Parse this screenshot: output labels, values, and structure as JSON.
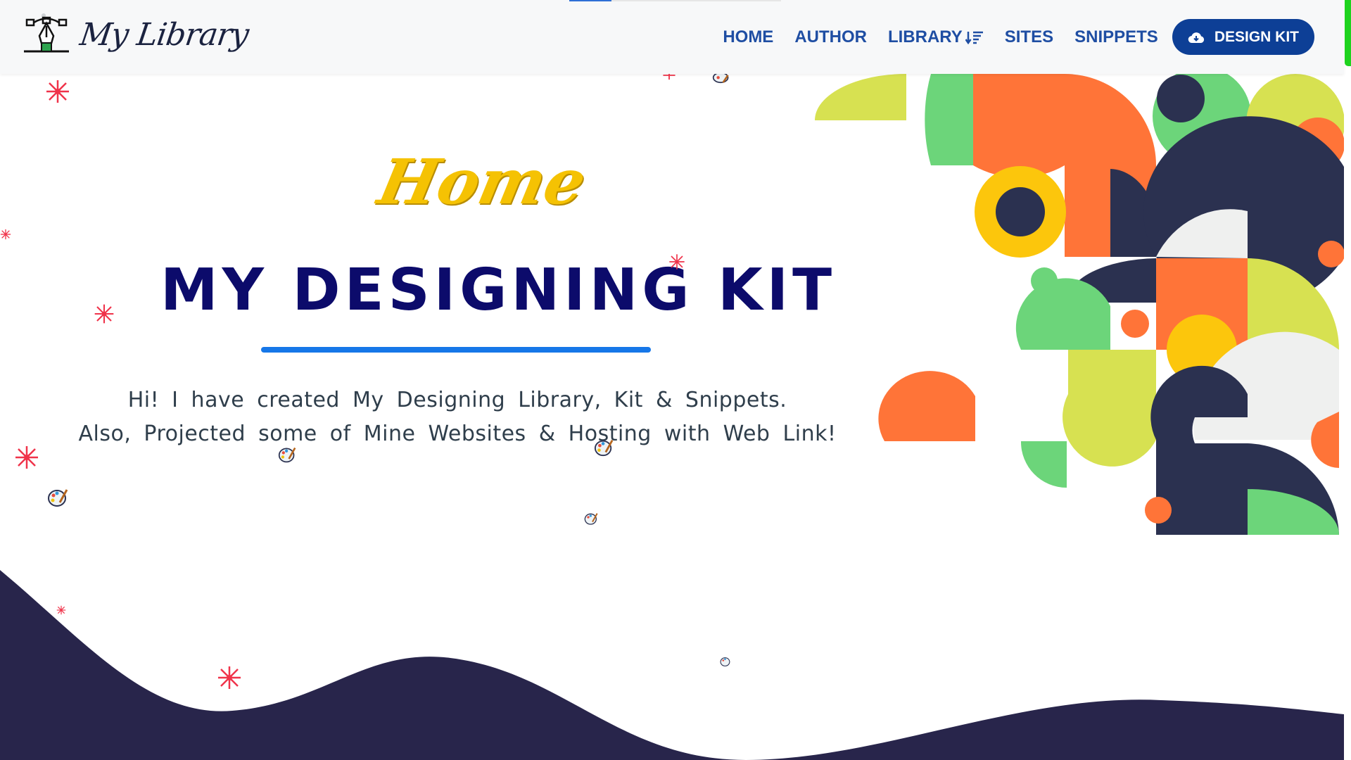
{
  "brand": {
    "name": "My Library"
  },
  "nav": {
    "items": [
      {
        "label": "HOME",
        "icon": ""
      },
      {
        "label": "AUTHOR",
        "icon": ""
      },
      {
        "label": "LIBRARY",
        "icon": "sort-icon"
      },
      {
        "label": "SITES",
        "icon": ""
      },
      {
        "label": "SNIPPETS",
        "icon": ""
      }
    ],
    "cta": {
      "label": "DESIGN KIT",
      "icon": "cloud-download-icon"
    }
  },
  "hero": {
    "script_heading": "Home",
    "title": "MY DESIGNING KIT",
    "line1": "Hi! I have created My Designing Library, Kit & Snippets.",
    "line2": "Also, Projected some of Mine Websites & Hosting with Web Link!"
  },
  "colors": {
    "nav_text": "#1f4ea3",
    "cta_bg": "#0d3f96",
    "title": "#0c0b6b",
    "script": "#f5c203",
    "underline": "#1677e8",
    "wave": "#28254b",
    "sparkle": "#f0334a",
    "scroll_indicator": "#1ed31e",
    "art_palette": [
      "#2b3150",
      "#ff7438",
      "#6cd57a",
      "#d7e151",
      "#fcc60c",
      "#eff0ef"
    ]
  }
}
